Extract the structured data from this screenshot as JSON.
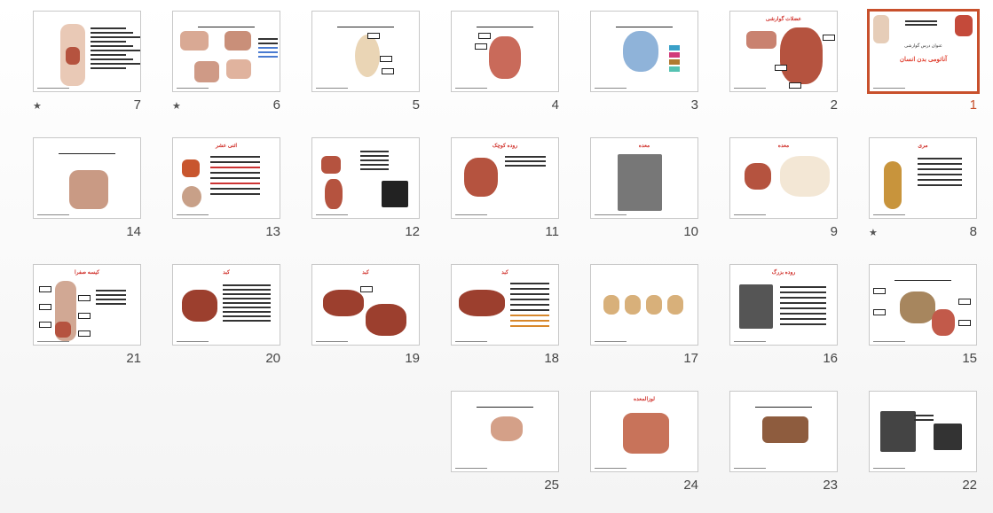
{
  "slides": [
    {
      "number": "7",
      "star": true
    },
    {
      "number": "6",
      "star": true
    },
    {
      "number": "5"
    },
    {
      "number": "4"
    },
    {
      "number": "3"
    },
    {
      "number": "2",
      "title": "عضلات گوارشی"
    },
    {
      "number": "1",
      "selected": true,
      "title": "آناتومی بدن انسان",
      "subtitle": "عنوان درس گوارشی"
    },
    {
      "number": "14"
    },
    {
      "number": "13",
      "title": "اثنی عشر"
    },
    {
      "number": "12"
    },
    {
      "number": "11",
      "title": "روده کوچک"
    },
    {
      "number": "10",
      "title": "معده"
    },
    {
      "number": "9",
      "title": "معده"
    },
    {
      "number": "8",
      "star": true,
      "title": "مری"
    },
    {
      "number": "21",
      "title": "کیسه صفرا"
    },
    {
      "number": "20",
      "title": "کبد"
    },
    {
      "number": "19",
      "title": "کبد"
    },
    {
      "number": "18",
      "title": "کبد"
    },
    {
      "number": "17"
    },
    {
      "number": "16",
      "title": "روده بزرگ"
    },
    {
      "number": "15"
    },
    {
      "number": "25"
    },
    {
      "number": "24",
      "title": "لوزالمعده"
    },
    {
      "number": "23"
    },
    {
      "number": "22"
    }
  ],
  "star_glyph": "★",
  "colors": {
    "selected": "#c8502c",
    "organ": "#b5533f",
    "liver": "#9c3f2e"
  }
}
